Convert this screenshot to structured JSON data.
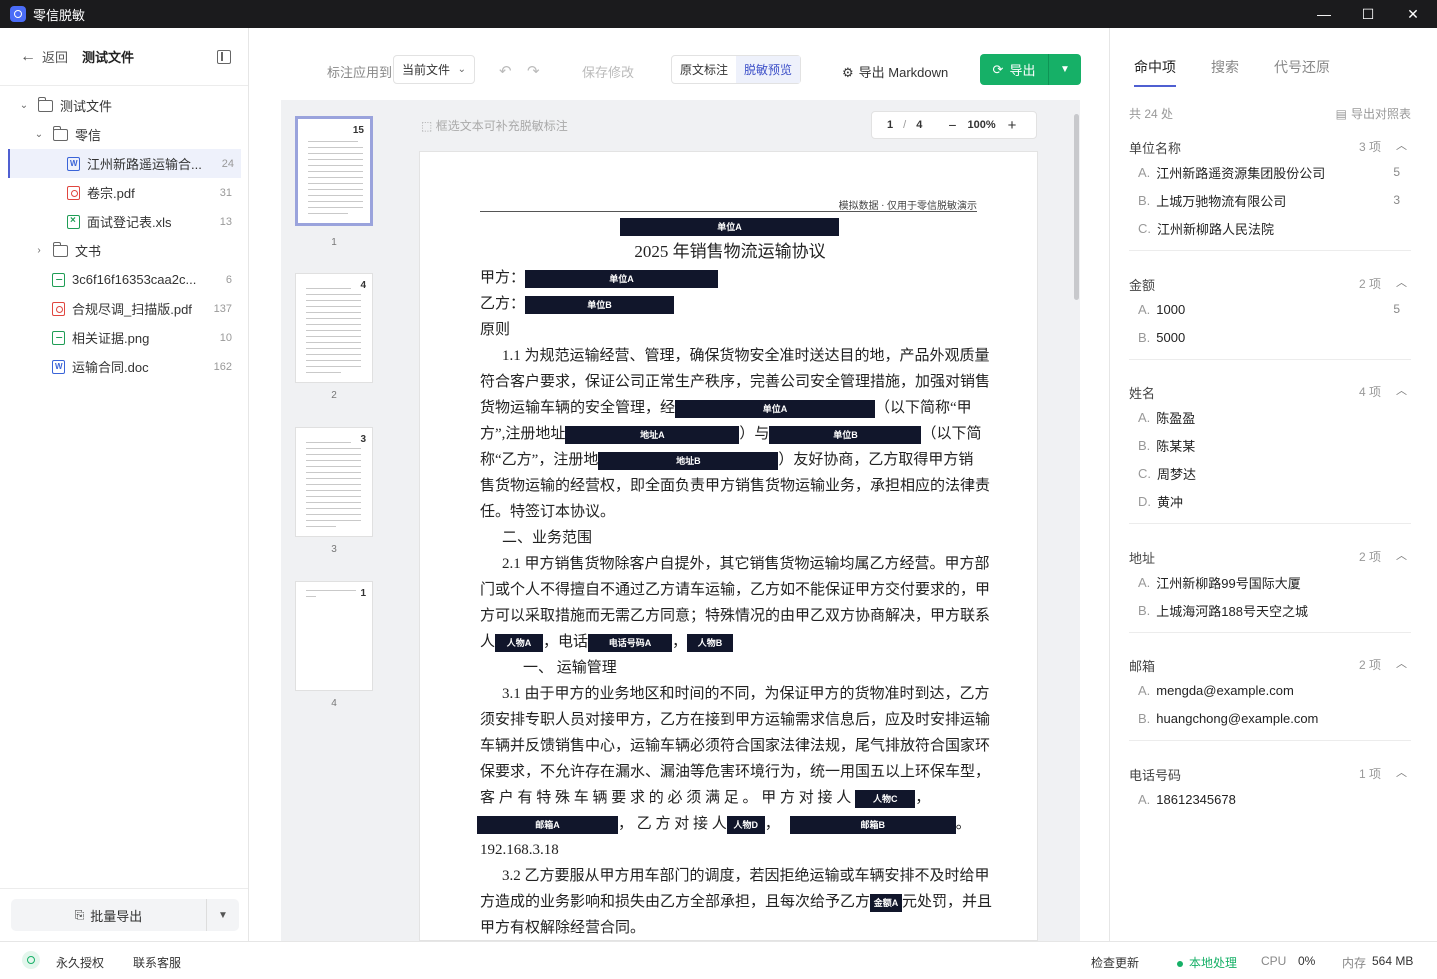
{
  "app": {
    "title": "零信脱敏"
  },
  "window_controls": {
    "minimize": "—",
    "maximize": "☐",
    "close": "✕"
  },
  "sidebar": {
    "back_label": "返回",
    "breadcrumb": "测试文件",
    "tree": [
      {
        "label": "测试文件",
        "type": "folder",
        "level": 0,
        "expanded": true
      },
      {
        "label": "零信",
        "type": "folder",
        "level": 1,
        "expanded": true
      },
      {
        "label": "江州新路遥运输合...",
        "type": "word",
        "level": 2,
        "count": "24",
        "selected": true
      },
      {
        "label": "卷宗.pdf",
        "type": "pdf",
        "level": 2,
        "count": "31"
      },
      {
        "label": "面试登记表.xls",
        "type": "xls",
        "level": 2,
        "count": "13"
      },
      {
        "label": "文书",
        "type": "folder",
        "level": 1,
        "expanded": false
      },
      {
        "label": "3c6f16f16353caa2c...",
        "type": "image",
        "level": 1,
        "count": "6"
      },
      {
        "label": "合规尽调_扫描版.pdf",
        "type": "pdf",
        "level": 1,
        "count": "137"
      },
      {
        "label": "相关证据.png",
        "type": "image",
        "level": 1,
        "count": "10"
      },
      {
        "label": "运输合同.doc",
        "type": "word",
        "level": 1,
        "count": "162"
      }
    ],
    "batch_export": "批量导出"
  },
  "toolbar": {
    "apply_label": "标注应用到",
    "apply_value": "当前文件",
    "save": "保存修改",
    "mode_original": "原文标注",
    "mode_preview": "脱敏预览",
    "export_md": "导出 Markdown",
    "export": "导出"
  },
  "viewer": {
    "hint": "框选文本可补充脱敏标注",
    "page_current": "1",
    "page_sep": "/",
    "page_total": "4",
    "zoom": "100%",
    "thumbs": [
      {
        "page": "1",
        "count": "15"
      },
      {
        "page": "2",
        "count": "4"
      },
      {
        "page": "3",
        "count": "3"
      },
      {
        "page": "4",
        "count": "1"
      }
    ]
  },
  "document": {
    "header_note": "模拟数据 · 仅用于零信脱敏演示",
    "title": "2025 年销售物流运输协议",
    "labels": {
      "party_a_tag": "单位A",
      "party_b_tag": "单位B",
      "addr_a": "地址A",
      "addr_b": "地址B",
      "person_a": "人物A",
      "person_b": "人物B",
      "person_c": "人物C",
      "person_d": "人物D",
      "phone_a": "电话号码A",
      "email_a": "邮箱A",
      "email_b": "邮箱B",
      "amount_a": "金额A"
    },
    "text": {
      "party_a": "甲方：",
      "party_b": "乙方：",
      "principle": "原则",
      "p1_1": "1.1 为规范运输经营、管理，确保货物安全准时送达目的地，产品外观质量",
      "p1_2": "符合客户要求，保证公司正常生产秩序，完善公司安全管理措施，加强对销售",
      "p1_3a": "货物运输车辆的安全管理，经",
      "p1_3b": "（以下简称“甲",
      "p1_4a": "方”,注册地址",
      "p1_4b": "）与",
      "p1_4c": "（以下简",
      "p1_5a": "称“乙方”，注册地",
      "p1_5b": "）友好协商，乙方取得甲方销",
      "p1_6": "售货物运输的经营权，即全面负责甲方销售货物运输业务，承担相应的法律责",
      "p1_7": "任。特签订本协议。",
      "s2": "二、业务范围",
      "p2_1": "2.1 甲方销售货物除客户自提外，其它销售货物运输均属乙方经营。甲方部",
      "p2_2": "门或个人不得擅自不通过乙方请车运输，乙方如不能保证甲方交付要求的，甲",
      "p2_3": "方可以采取措施而无需乙方同意；特殊情况的由甲乙双方协商解决，甲方联系",
      "p2_4a": "人",
      "p2_4b": "，电话",
      "p2_4c": "，",
      "s3": "一、   运输管理",
      "p3_1": "3.1 由于甲方的业务地区和时间的不同，为保证甲方的货物准时到达，乙方",
      "p3_2": "须安排专职人员对接甲方，乙方在接到甲方运输需求信息后，应及时安排运输",
      "p3_3": "车辆并反馈销售中心，运输车辆必须符合国家法律法规，尾气排放符合国家环",
      "p3_4": "保要求，不允许存在漏水、漏油等危害环境行为，统一用国五以上环保车型，",
      "p3_5a": "客 户 有 特 殊 车 辆 要 求 的 必 须 满 足 。 甲 方 对 接 人",
      "p3_5b": "，",
      "p3_6a": "，  乙 方 对 接 人",
      "p3_6b": "，",
      "p3_6c": "。",
      "p3_7": "192.168.3.18",
      "p3_8": "3.2 乙方要服从甲方用车部门的调度，若因拒绝运输或车辆安排不及时给甲",
      "p3_9a": "方造成的业务影响和损失由乙方全部承担，且每次给予乙方",
      "p3_9b": "元处罚，并且",
      "p3_10": "甲方有权解除经营合同。"
    }
  },
  "right_panel": {
    "tabs": [
      "命中项",
      "搜索",
      "代号还原"
    ],
    "total": "共 24 处",
    "export_map": "导出对照表",
    "groups": [
      {
        "title": "单位名称",
        "count": "3 项",
        "items": [
          {
            "letter": "A.",
            "text": "江州新路遥资源集团股份公司",
            "n": "5"
          },
          {
            "letter": "B.",
            "text": "上城万驰物流有限公司",
            "n": "3"
          },
          {
            "letter": "C.",
            "text": "江州新柳路人民法院",
            "n": ""
          }
        ]
      },
      {
        "title": "金额",
        "count": "2 项",
        "items": [
          {
            "letter": "A.",
            "text": "1000",
            "n": "5"
          },
          {
            "letter": "B.",
            "text": "5000",
            "n": ""
          }
        ]
      },
      {
        "title": "姓名",
        "count": "4 项",
        "items": [
          {
            "letter": "A.",
            "text": "陈盈盈",
            "n": ""
          },
          {
            "letter": "B.",
            "text": "陈某某",
            "n": ""
          },
          {
            "letter": "C.",
            "text": "周梦达",
            "n": ""
          },
          {
            "letter": "D.",
            "text": "黄冲",
            "n": ""
          }
        ]
      },
      {
        "title": "地址",
        "count": "2 项",
        "items": [
          {
            "letter": "A.",
            "text": "江州新柳路99号国际大厦",
            "n": ""
          },
          {
            "letter": "B.",
            "text": "上城海河路188号天空之城",
            "n": ""
          }
        ]
      },
      {
        "title": "邮箱",
        "count": "2 项",
        "items": [
          {
            "letter": "A.",
            "text": "mengda@example.com",
            "n": ""
          },
          {
            "letter": "B.",
            "text": "huangchong@example.com",
            "n": ""
          }
        ]
      },
      {
        "title": "电话号码",
        "count": "1 项",
        "items": [
          {
            "letter": "A.",
            "text": "18612345678",
            "n": ""
          }
        ]
      }
    ]
  },
  "status": {
    "license": "永久授权",
    "support": "联系客服",
    "update": "检查更新",
    "local": "本地处理",
    "cpu_label": "CPU",
    "cpu_value": "0%",
    "mem_label": "内存",
    "mem_value": "564 MB"
  }
}
